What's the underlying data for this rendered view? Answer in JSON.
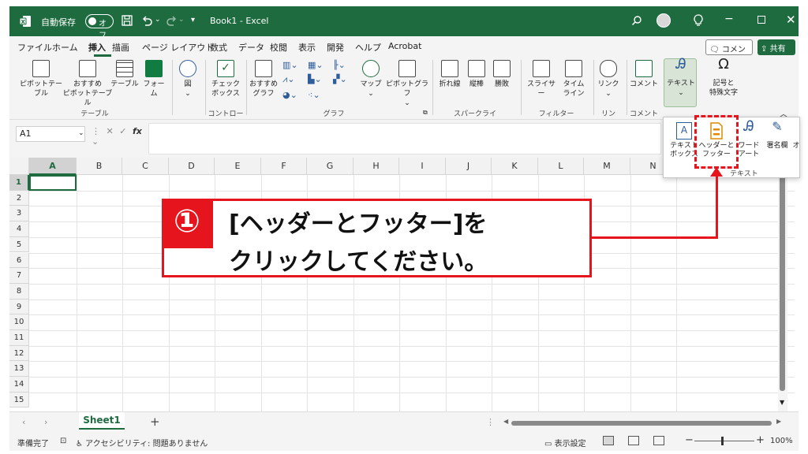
{
  "titlebar": {
    "autosave_label": "自動保存",
    "autosave_state": "オフ",
    "doc_title": "Book1  -  Excel"
  },
  "tabs": [
    "ファイル",
    "ホーム",
    "挿入",
    "描画",
    "ページ レイアウト",
    "数式",
    "データ",
    "校閲",
    "表示",
    "開発",
    "ヘルプ",
    "Acrobat"
  ],
  "active_tab": "挿入",
  "comment_button": "コメント",
  "share_button": "共有",
  "ribbon": {
    "pivot_table": "ピボットテー\nブル",
    "recommended_pivot": "おすすめ\nピボットテーブル",
    "table": "テーブル",
    "forms": "フォー\nム",
    "illustrations": "図",
    "checkbox": "チェック\nボックス",
    "recommended_charts": "おすすめ\nグラフ",
    "maps": "マップ",
    "pivot_chart": "ピボットグラフ",
    "line_spark": "折れ線",
    "column_spark": "縦棒",
    "winloss_spark": "勝敗",
    "slicer": "スライサー",
    "timeline": "タイム\nライン",
    "link": "リンク",
    "comment": "コメント",
    "text": "テキスト",
    "symbols": "記号と\n特殊文字",
    "groups": {
      "table": "テーブル",
      "controls": "コントロール",
      "charts": "グラフ",
      "sparklines": "スパークライン",
      "filters": "フィルター",
      "links": "リンク",
      "comments": "コメント"
    }
  },
  "text_popup": {
    "textbox": "テキスト\nボックス",
    "header_footer": "ヘッダーと\nフッター",
    "wordart": "ワード\nアート",
    "signature": "署名欄",
    "object": "オ",
    "group_label": "テキスト"
  },
  "formula_bar": {
    "name_box": "A1",
    "fx": "fx",
    "value": ""
  },
  "grid": {
    "columns": [
      "A",
      "B",
      "C",
      "D",
      "E",
      "F",
      "G",
      "H",
      "I",
      "J",
      "K",
      "L",
      "M",
      "N"
    ],
    "rows": [
      "1",
      "2",
      "3",
      "4",
      "5",
      "6",
      "7",
      "8",
      "9",
      "10",
      "11",
      "12",
      "13",
      "14",
      "15"
    ],
    "selected_cell": "A1"
  },
  "sheet_tab": "Sheet1",
  "statusbar": {
    "ready": "準備完了",
    "accessibility": "アクセシビリティ: 問題ありません",
    "display_settings": "表示設定",
    "zoom": "100%"
  },
  "callout": {
    "number": "①",
    "line1": "[ヘッダーとフッター]を",
    "line2": "クリックしてください。"
  },
  "colors": {
    "excel_green": "#1e6b3f",
    "annotation_red": "#e5141d"
  }
}
